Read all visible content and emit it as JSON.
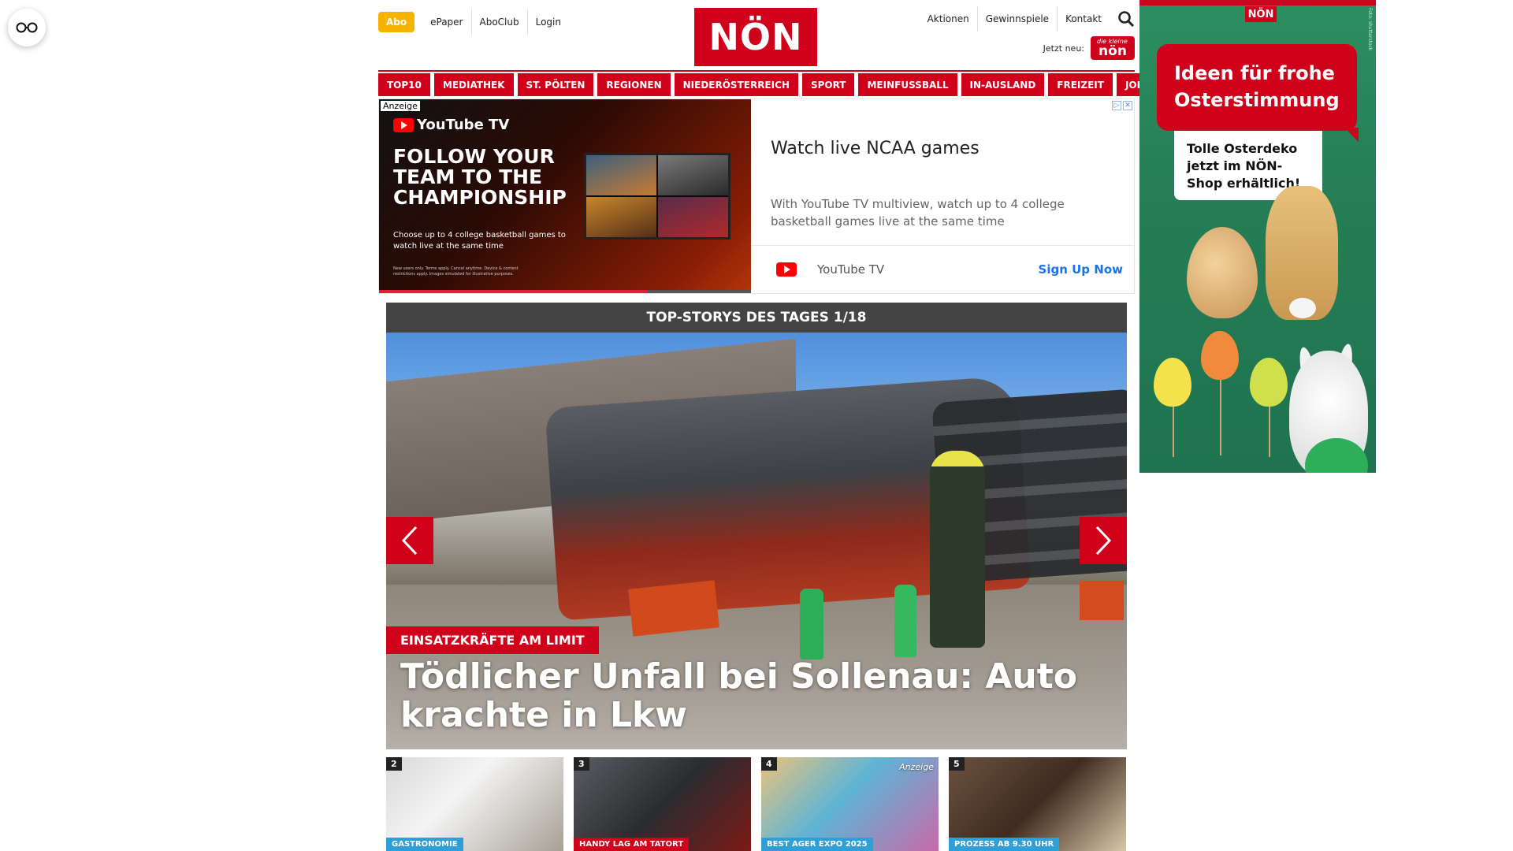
{
  "header": {
    "abo": "Abo",
    "top_links": [
      "ePaper",
      "AboClub",
      "Login"
    ],
    "logo": "NÖN",
    "right_links": [
      "Aktionen",
      "Gewinnspiele",
      "Kontakt"
    ],
    "jetzt_label": "Jetzt neu:",
    "jetzt_badge_small": "die kleine",
    "jetzt_badge": "nön"
  },
  "nav": [
    "TOP10",
    "MEDIATHEK",
    "ST. PÖLTEN",
    "REGIONEN",
    "NIEDERÖSTERREICH",
    "SPORT",
    "MEINFUSSBALL",
    "IN-AUSLAND",
    "FREIZEIT",
    "JOB & KARRIERE"
  ],
  "ad": {
    "label": "Anzeige",
    "yt_brand": "YouTube TV",
    "headline": "FOLLOW YOUR TEAM TO THE CHAMPIONSHIP",
    "subline": "Choose up to 4 college basketball games to watch live at the same time",
    "fineprint": "New users only. Terms apply. Cancel anytime. Device & content restrictions apply. Images simulated for illustrative purposes.",
    "title": "Watch live NCAA games",
    "description": "With YouTube TV multiview, watch up to 4 college basketball games live at the same time",
    "brand": "YouTube TV",
    "cta": "Sign Up Now"
  },
  "stories": {
    "heading": "TOP-STORYS DES TAGES 1/18",
    "hero_tag": "EINSATZKRÄFTE AM LIMIT",
    "hero_title": "Tödlicher Unfall bei Sollenau: Auto krachte in Lkw",
    "thumbs": [
      {
        "num": "2",
        "cat": "GASTRONOMIE",
        "anzeige": ""
      },
      {
        "num": "3",
        "cat": "HANDY LAG AM TATORT",
        "anzeige": ""
      },
      {
        "num": "4",
        "cat": "BEST AGER EXPO 2025",
        "anzeige": "Anzeige"
      },
      {
        "num": "5",
        "cat": "PROZESS AB 9.30 UHR",
        "anzeige": ""
      }
    ]
  },
  "sky_ad": {
    "logo": "NÖN",
    "headline": "Ideen für frohe Osterstimmung",
    "note": "Tolle Osterdeko jetzt im NÖN-Shop erhältlich!",
    "credit": "Foto: shutterstock"
  },
  "colors": {
    "brand_red": "#d0021b",
    "abo_yellow": "#f6b300",
    "cta_blue": "#1a73e8",
    "sky_green": "#257e55"
  }
}
